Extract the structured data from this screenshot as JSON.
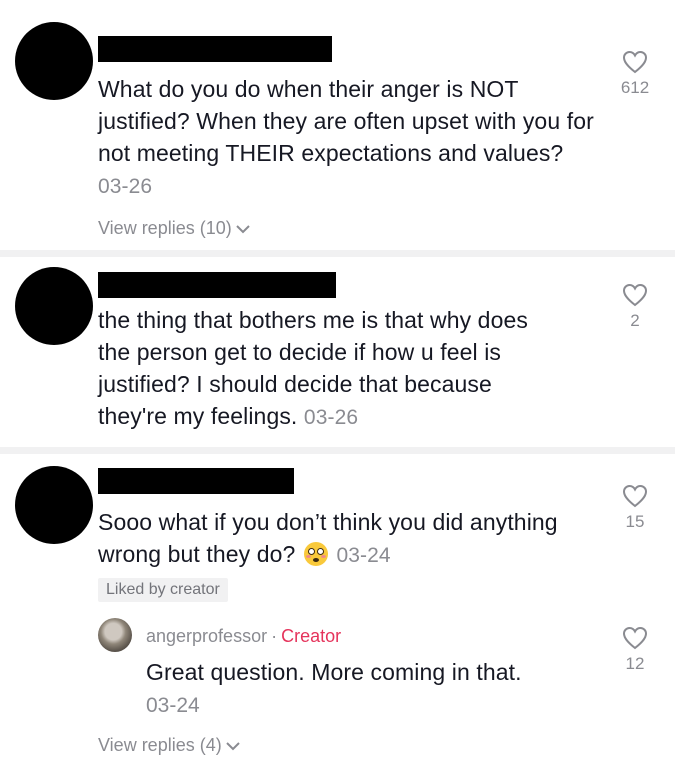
{
  "comments": [
    {
      "text": "What do you do when their anger is NOT justified? When they are often upset with you for not meeting THEIR expectations and values?",
      "date": "03-26",
      "likes": "612",
      "view_replies": "View replies (10)"
    },
    {
      "text": "the thing that bothers me is that why does the person get to decide if how u feel is justified? I should decide that because they're my feelings.",
      "date": "03-26",
      "likes": "2"
    },
    {
      "text": "Sooo what if you don’t think you did anything wrong but they do?",
      "emoji": "flushed-face-emoji",
      "date": "03-24",
      "likes": "15",
      "liked_badge": "Liked by creator",
      "reply": {
        "username": "angerprofessor",
        "separator": "·",
        "role": "Creator",
        "text": "Great question. More coming in that.",
        "date": "03-24",
        "likes": "12"
      },
      "view_replies": "View replies (4)"
    }
  ],
  "icons": {
    "like": "heart-outline-icon",
    "expand": "chevron-down-icon"
  },
  "colors": {
    "secondary_text": "#8a8b91",
    "creator": "#e5335b",
    "divider": "#f1f1f2"
  }
}
